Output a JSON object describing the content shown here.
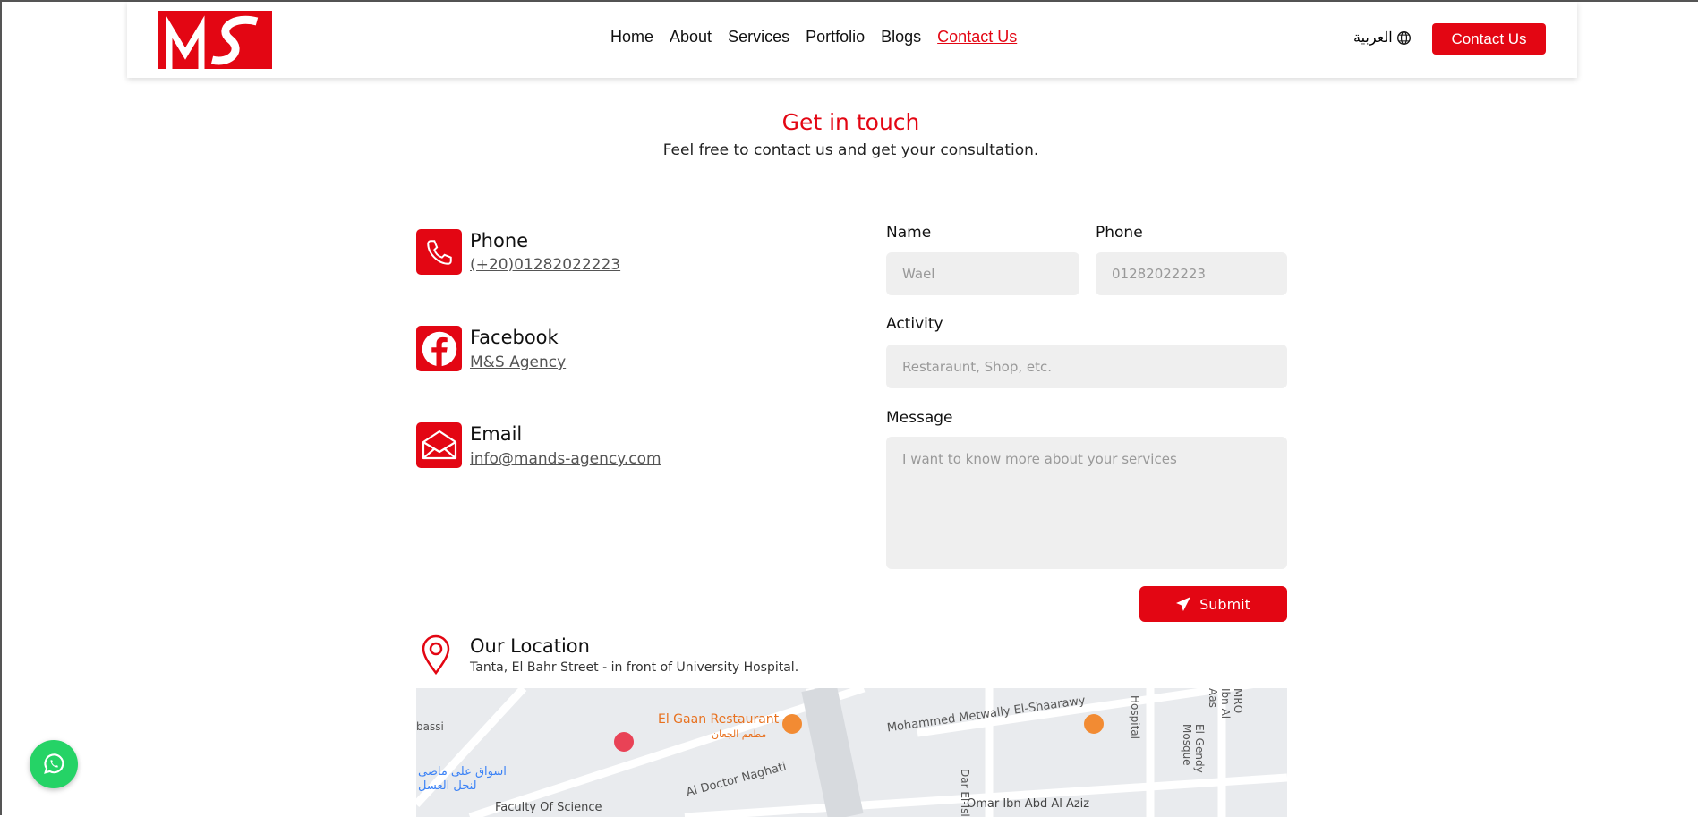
{
  "header": {
    "logo_text": "MS",
    "nav": [
      "Home",
      "About",
      "Services",
      "Portfolio",
      "Blogs",
      "Contact Us"
    ],
    "active_nav": "Contact Us",
    "language": "العربية",
    "cta": "Contact Us"
  },
  "intro": {
    "title": "Get in touch",
    "subtitle": "Feel free to contact us and get your consultation."
  },
  "contacts": [
    {
      "title": "Phone",
      "value": "(+20)01282022223",
      "icon": "phone-icon"
    },
    {
      "title": "Facebook",
      "value": "M&S Agency",
      "icon": "facebook-icon"
    },
    {
      "title": "Email",
      "value": "info@mands-agency.com",
      "icon": "envelope-icon"
    }
  ],
  "form": {
    "name_label": "Name",
    "name_placeholder": "Wael",
    "phone_label": "Phone",
    "phone_placeholder": "01282022223",
    "activity_label": "Activity",
    "activity_placeholder": "Restaraunt, Shop, etc.",
    "message_label": "Message",
    "message_placeholder": "I want to know more about your services",
    "submit": "Submit"
  },
  "location": {
    "title": "Our Location",
    "address": "Tanta, El Bahr Street - in front of University Hospital."
  },
  "map": {
    "labels": [
      "El Gaan Restaurant",
      "مطعم الجعان",
      "Mohammed Metwally El-Shaarawy",
      "Dar El-Islam",
      "Hospital",
      "El-Gendy Mosque",
      "MRO Ibn Al Aas",
      "Al Doctor Naghati",
      "Omar Ibn Abd Al Aziz",
      "Faculty Of Science",
      "اسواق على ماضى",
      "لنحل العسل",
      "bassi"
    ]
  },
  "colors": {
    "brand": "#e30613",
    "whatsapp": "#25d366"
  }
}
